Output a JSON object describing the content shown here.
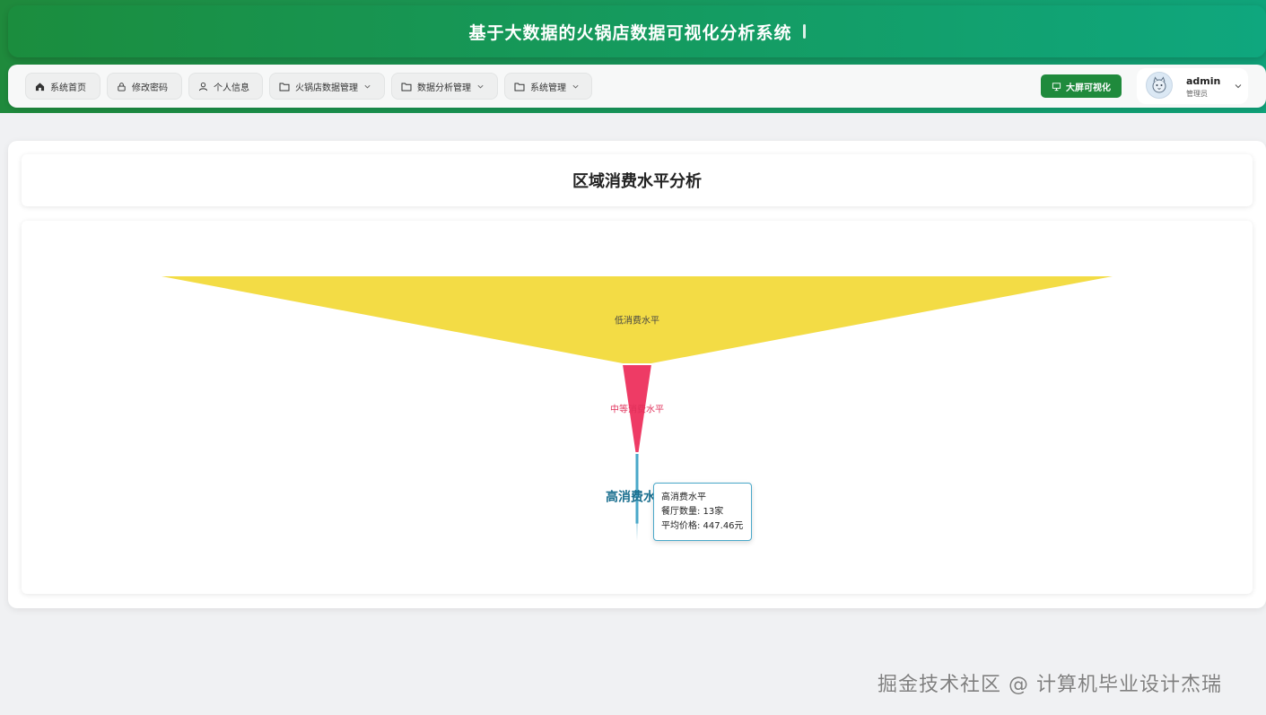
{
  "app": {
    "title": "基于大数据的火锅店数据可视化分析系统"
  },
  "nav": {
    "items": [
      {
        "label": "系统首页",
        "icon": "home-icon",
        "dropdown": false
      },
      {
        "label": "修改密码",
        "icon": "lock-icon",
        "dropdown": false
      },
      {
        "label": "个人信息",
        "icon": "user-icon",
        "dropdown": false
      },
      {
        "label": "火锅店数据管理",
        "icon": "folder-icon",
        "dropdown": true
      },
      {
        "label": "数据分析管理",
        "icon": "folder-icon",
        "dropdown": true
      },
      {
        "label": "系统管理",
        "icon": "folder-icon",
        "dropdown": true
      }
    ],
    "big_screen_label": "大屏可视化"
  },
  "user": {
    "name": "admin",
    "role": "管理员"
  },
  "page": {
    "title": "区域消费水平分析"
  },
  "chart_data": {
    "type": "funnel",
    "categories": [
      "低消费水平",
      "中等消费水平",
      "高消费水平"
    ],
    "series": [
      {
        "values": [
          100,
          3,
          0.3
        ]
      }
    ],
    "colors": [
      "#f3dc45",
      "#ee3b65",
      "#4aa8c9"
    ]
  },
  "tooltip": {
    "title": "高消费水平",
    "line1": "餐厅数量: 13家",
    "line2": "平均价格: 447.46元"
  },
  "watermark": "掘金技术社区 @ 计算机毕业设计杰瑞",
  "colors": {
    "primary": "#1f8a3c",
    "accent": "#10a37a"
  }
}
